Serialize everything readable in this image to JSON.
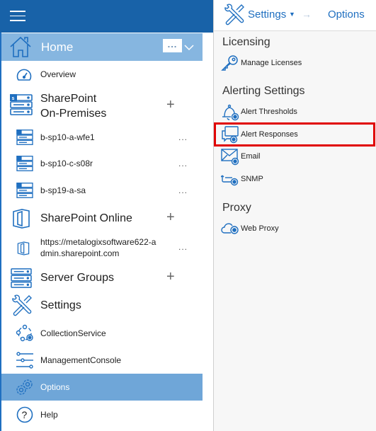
{
  "colors": {
    "topbar": "#1862a8",
    "accent": "#1f6fc0",
    "home_bg": "#86b6e0",
    "selected_bg": "#6fa6d8",
    "panel_bg": "#f7f7f7",
    "highlight": "#e00000"
  },
  "sidebar": {
    "menu_icon": "hamburger-icon",
    "home": {
      "label": "Home",
      "icon": "home-icon",
      "more": "...",
      "chevron": "chevron-down-icon"
    },
    "overview": {
      "label": "Overview",
      "icon": "speedometer-icon"
    },
    "sharepoint_onprem": {
      "label_line1": "SharePoint",
      "label_line2": "On-Premises",
      "icon": "sharepoint-server-icon",
      "add": "+",
      "servers": [
        {
          "label": "b-sp10-a-wfe1",
          "more": "..."
        },
        {
          "label": "b-sp10-c-s08r",
          "more": "..."
        },
        {
          "label": "b-sp19-a-sa",
          "more": "..."
        }
      ]
    },
    "sharepoint_online": {
      "label": "SharePoint Online",
      "icon": "office-door-icon",
      "add": "+",
      "tenants": [
        {
          "label_line1": "https://metalogixsoftware622-a",
          "label_line2": "dmin.sharepoint.com",
          "more": "..."
        }
      ]
    },
    "server_groups": {
      "label": "Server Groups",
      "icon": "server-stack-icon",
      "add": "+"
    },
    "settings": {
      "label": "Settings",
      "icon": "tools-icon",
      "children": [
        {
          "label": "CollectionService",
          "icon": "collection-service-icon"
        },
        {
          "label": "ManagementConsole",
          "icon": "sliders-icon"
        },
        {
          "label": "Options",
          "icon": "gears-icon",
          "selected": true
        }
      ]
    },
    "help": {
      "label": "Help",
      "icon": "help-icon"
    }
  },
  "panel": {
    "breadcrumb": {
      "icon": "tools-icon",
      "settings": "Settings",
      "caret": "▼",
      "arrow": "→",
      "options": "Options"
    },
    "sections": [
      {
        "title": "Licensing",
        "items": [
          {
            "label": "Manage Licenses",
            "icon": "key-icon"
          }
        ]
      },
      {
        "title": "Alerting Settings",
        "items": [
          {
            "label": "Alert Thresholds",
            "icon": "bell-icon"
          },
          {
            "label": "Alert Responses",
            "icon": "chat-monitor-icon",
            "highlighted": true
          },
          {
            "label": "Email",
            "icon": "envelope-icon"
          },
          {
            "label": "SNMP",
            "icon": "snmp-icon"
          }
        ]
      },
      {
        "title": "Proxy",
        "items": [
          {
            "label": "Web Proxy",
            "icon": "cloud-icon"
          }
        ]
      }
    ]
  }
}
